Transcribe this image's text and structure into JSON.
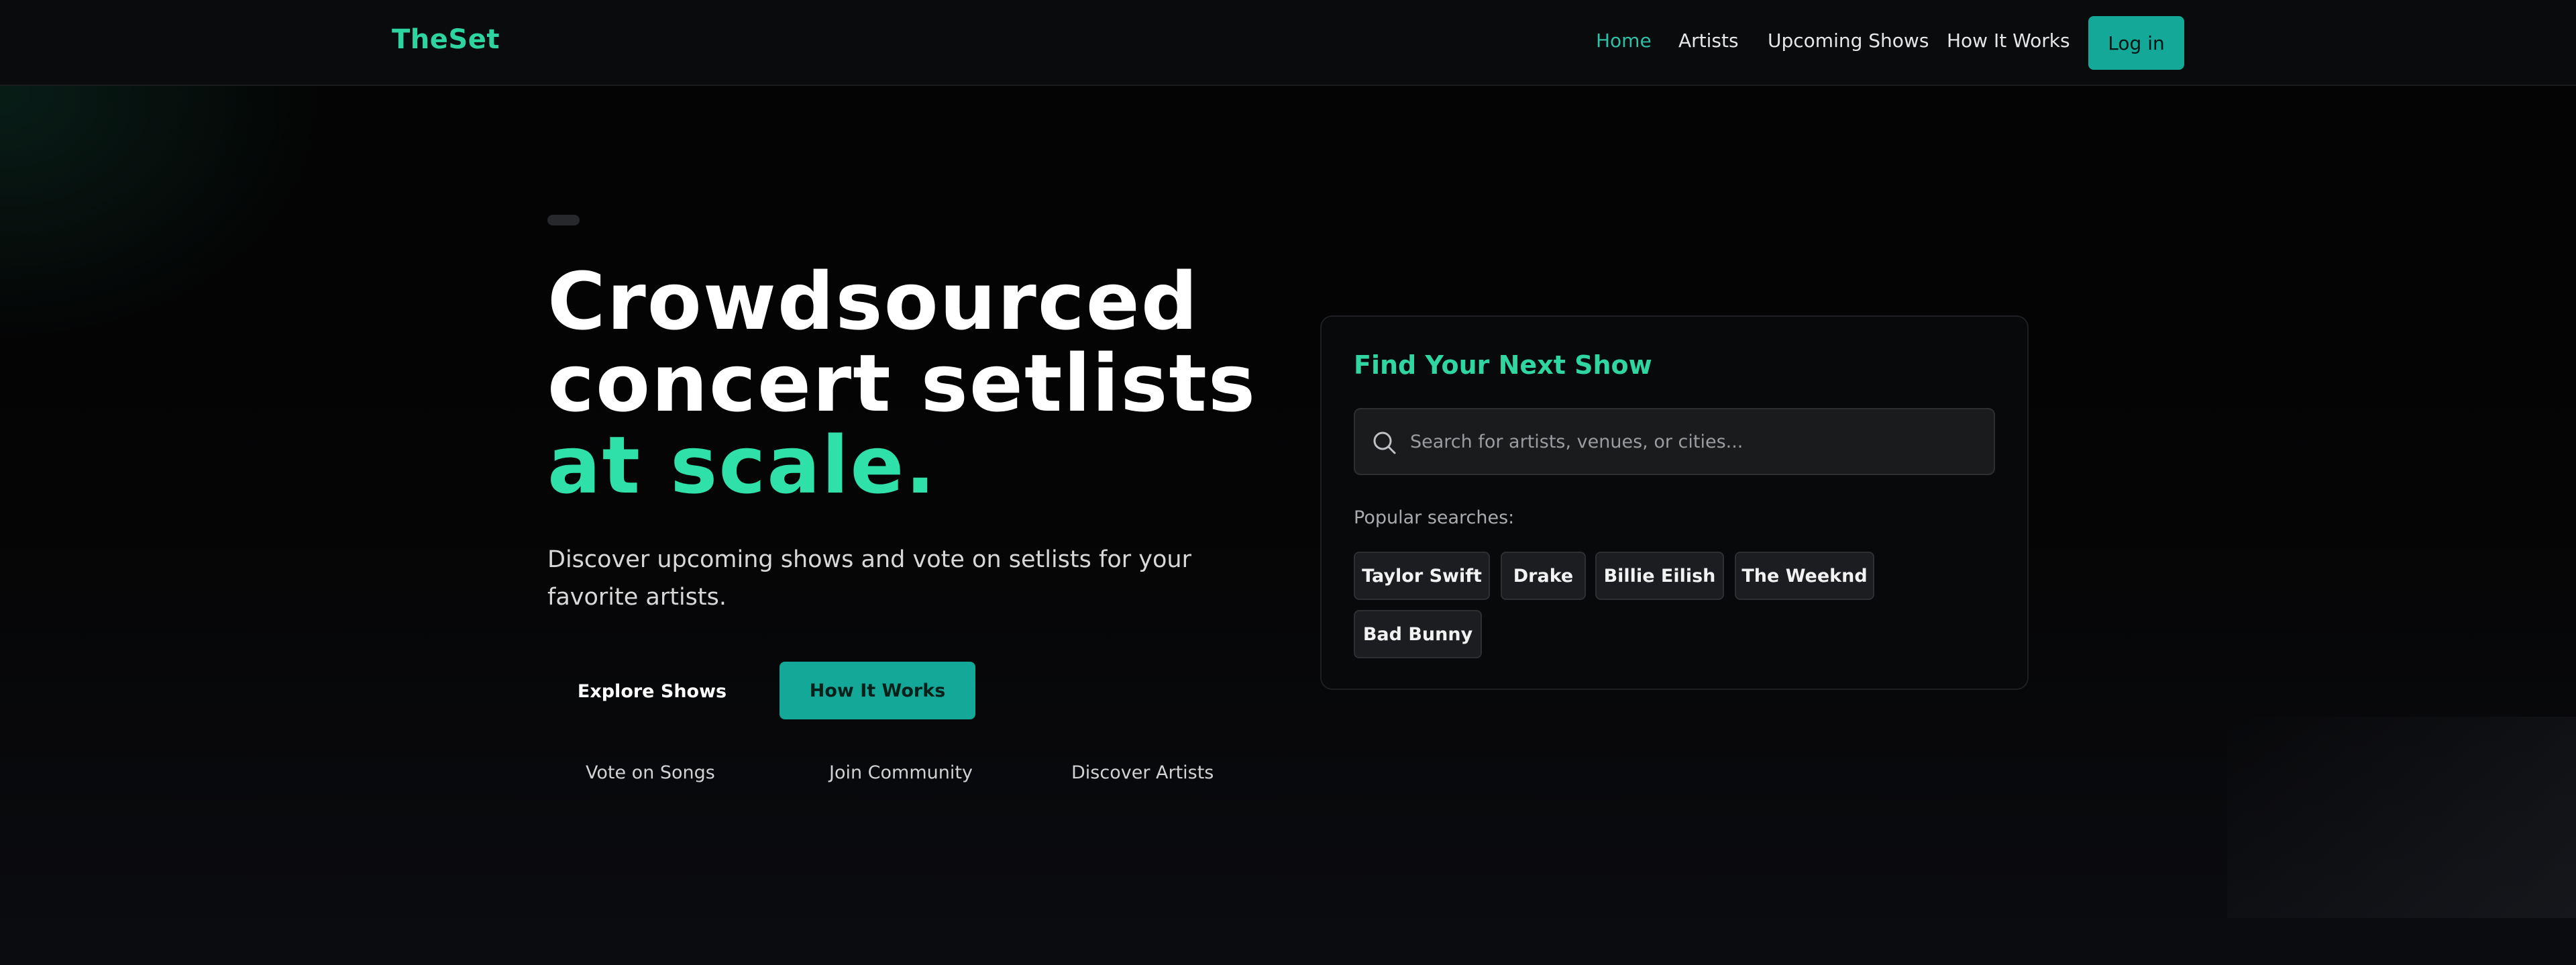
{
  "colors": {
    "accent": "#2fe0a8",
    "button": "#14a898",
    "background": "#050607"
  },
  "nav": {
    "logo": "TheSet",
    "links": [
      {
        "label": "Home",
        "active": true
      },
      {
        "label": "Artists",
        "active": false
      },
      {
        "label": "Upcoming Shows",
        "active": false
      },
      {
        "label": "How It Works",
        "active": false
      }
    ],
    "login_label": "Log in"
  },
  "hero": {
    "headline_main": "Crowdsourced concert setlists ",
    "headline_accent": "at scale.",
    "subtitle": "Discover upcoming shows and vote on setlists for your favorite artists.",
    "primary_button": "Explore Shows",
    "secondary_button": "How It Works",
    "features": [
      "Vote on Songs",
      "Join Community",
      "Discover Artists"
    ]
  },
  "search_card": {
    "title": "Find Your Next Show",
    "search_placeholder": "Search for artists, venues, or cities...",
    "search_value": "",
    "popular_label": "Popular searches:",
    "popular_searches": [
      "Taylor Swift",
      "Drake",
      "Billie Eilish",
      "The Weeknd",
      "Bad Bunny"
    ],
    "icon": "search-icon"
  }
}
